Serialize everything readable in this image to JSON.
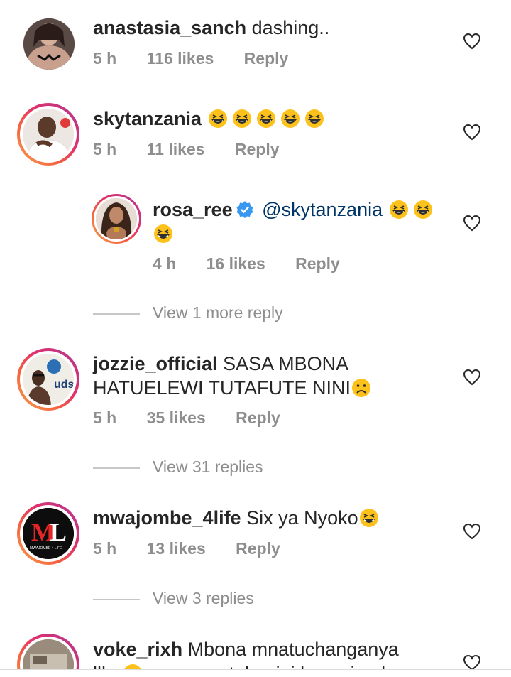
{
  "comments": [
    {
      "username": "anastasia_sanch",
      "text": "dashing..",
      "time": "5 h",
      "likes": "116 likes",
      "reply": "Reply"
    },
    {
      "username": "skytanzania",
      "text": "",
      "emoji": "grinning-squint-face x5",
      "time": "5 h",
      "likes": "11 likes",
      "reply": "Reply"
    },
    {
      "username": "rosa_ree",
      "verified": true,
      "mention": "@skytanzania",
      "emoji": "grinning-squint-face x3",
      "time": "4 h",
      "likes": "16 likes",
      "reply": "Reply",
      "view_more": "View 1 more reply"
    },
    {
      "username": "jozzie_official",
      "text_line1": "SASA MBONA",
      "text_line2": "HATUELEWI TUTAFUTE NINI",
      "time": "5 h",
      "likes": "35 likes",
      "reply": "Reply",
      "view_more": "View 31 replies"
    },
    {
      "username": "mwajombe_4life",
      "text": "Six ya Nyoko",
      "avatar_text": "ML",
      "avatar_subtext": "MWAJOMBE 4 LIFE",
      "time": "5 h",
      "likes": "13 likes",
      "reply": "Reply",
      "view_more": "View 3 replies"
    },
    {
      "username": "voke_rixh",
      "text_line1": "Mbona mnatuchanganya",
      "text_line2": "llkn",
      "text_line2b": "sasa mnatakanini kwa uiumla"
    }
  ],
  "colors": {
    "text": "#262626",
    "meta": "#8e8e8e",
    "mention": "#003569",
    "verified": "#3897f0"
  }
}
